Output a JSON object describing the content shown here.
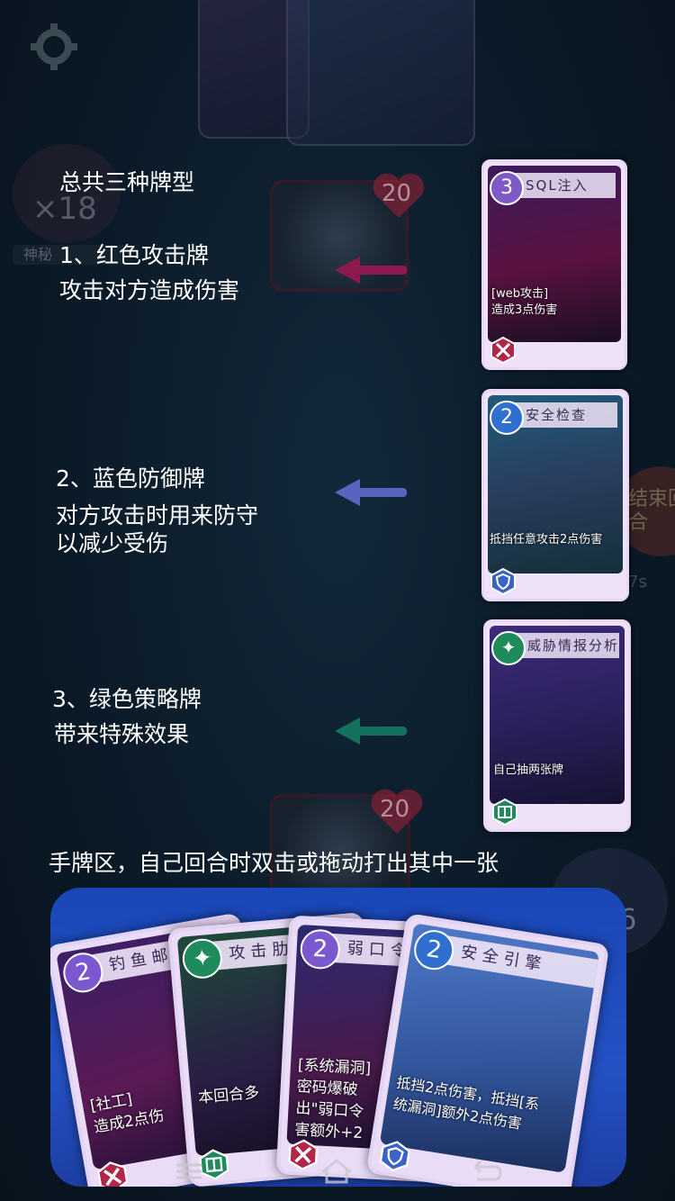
{
  "tutorial": {
    "heading": "总共三种牌型",
    "red": {
      "line1": "1、红色攻击牌",
      "line2": "攻击对方造成伤害"
    },
    "blue": {
      "line1": "2、蓝色防御牌",
      "line2": "对方攻击时用来防守",
      "line3": "以减少受伤"
    },
    "green": {
      "line1": "3、绿色策略牌",
      "line2": "带来特殊效果"
    },
    "hand_hint": "手牌区，自己回合时双击或拖动打出其中一张"
  },
  "colors": {
    "attack_arrow": "#8c1a4e",
    "defense_arrow": "#5865c0",
    "strategy_arrow": "#13715c"
  },
  "background": {
    "deck_count": "×18",
    "enemy_hp": "20",
    "player_hp": "20",
    "end_turn_label": "结束回合",
    "timer": "7s",
    "player_deck_count": "×16",
    "name_label": "神秘"
  },
  "reference_cards": [
    {
      "type": "attack",
      "cost": "3",
      "title": "SQL注入",
      "desc1": "[web攻击]",
      "desc2": "造成3点伤害",
      "icon": "crossed-swords-icon"
    },
    {
      "type": "defense",
      "cost": "2",
      "title": "安全检查",
      "desc1": "抵挡任意攻击2点伤害",
      "icon": "shield-icon"
    },
    {
      "type": "strategy",
      "cost": "",
      "title": "威胁情报分析",
      "desc1": "自己抽两张牌",
      "icon": "book-icon"
    }
  ],
  "hand_cards": [
    {
      "type": "attack",
      "cost": "2",
      "title": "钓鱼邮件",
      "desc1": "[社工]",
      "desc2": "造成2点伤",
      "icon": "crossed-swords-icon"
    },
    {
      "type": "strategy",
      "cost": "",
      "title": "攻击肋",
      "desc1": "本回合多",
      "icon": "book-icon"
    },
    {
      "type": "attack",
      "cost": "2",
      "title": "弱口令",
      "desc1": "[系统漏洞]",
      "desc2": "密码爆破",
      "desc3": "出\"弱口令",
      "desc4": "害额外+2",
      "icon": "crossed-swords-icon"
    },
    {
      "type": "defense",
      "cost": "2",
      "title": "安全引擎",
      "desc1": "抵挡2点伤害，抵挡[系",
      "desc2": "统漏洞]额外2点伤害",
      "icon": "shield-icon"
    }
  ],
  "navbar": {
    "items": [
      "menu-icon",
      "home-icon",
      "back-icon"
    ]
  }
}
